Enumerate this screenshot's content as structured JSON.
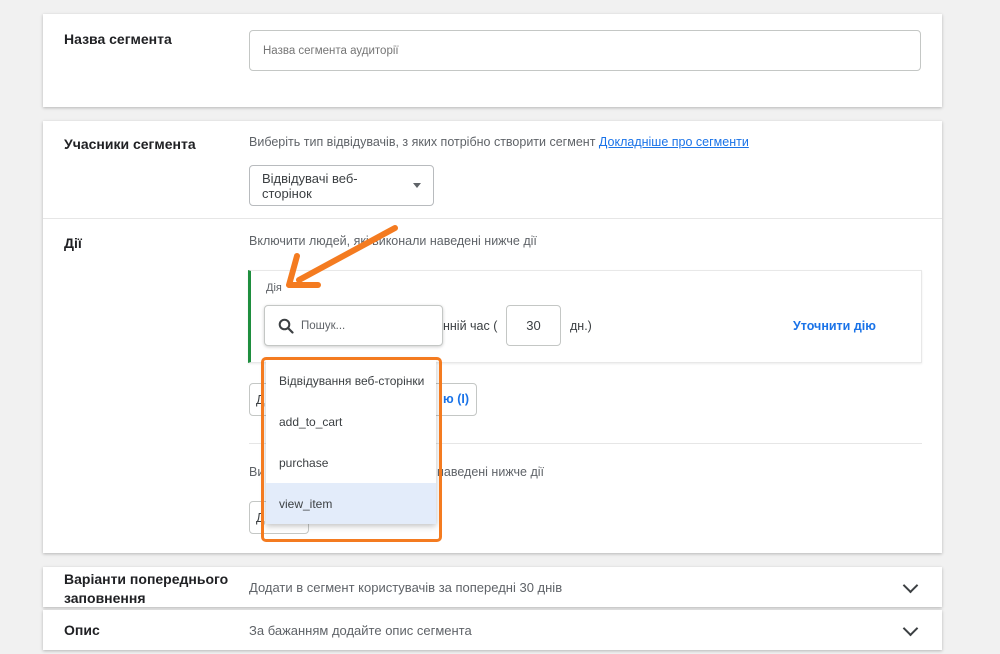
{
  "segment_name": {
    "label": "Назва сегмента",
    "placeholder": "Назва сегмента аудиторії"
  },
  "members": {
    "label": "Учасники сегмента",
    "description": "Виберіть тип відвідувачів, з яких потрібно створити сегмент",
    "learn_more_link": "Докладніше про сегменти",
    "visitor_type": "Відвідувачі веб-сторінок"
  },
  "actions": {
    "label": "Дії",
    "include_text": "Включити людей, які виконали наведені нижче дії",
    "action_field_label": "Дія",
    "search_placeholder": "Пошук...",
    "time_prefix": "нній час (",
    "days_value": "30",
    "days_suffix": "дн.)",
    "refine_link": "Уточнити дію",
    "add_action_partial": "ю (І)",
    "exclude_text_left": "Ви",
    "exclude_text_right": "наведені нижче дії",
    "obscured_button_left_1": "Д",
    "obscured_button_left_2": "Д",
    "dropdown_options": [
      "Відвідування веб-сторінки",
      "add_to_cart",
      "purchase",
      "view_item"
    ],
    "highlighted_option_index": 3
  },
  "prefill": {
    "label_line1": "Варіанти попереднього",
    "label_line2": "заповнення",
    "value": "Додати в сегмент користувачів за попередні 30 днів"
  },
  "description_section": {
    "label": "Опис",
    "value": "За бажанням додайте опис сегмента"
  },
  "colors": {
    "highlight_orange": "#f47b20",
    "link_blue": "#1a73e8",
    "accent_green": "#1e8e3e",
    "selected_row": "#e3ecfa"
  }
}
